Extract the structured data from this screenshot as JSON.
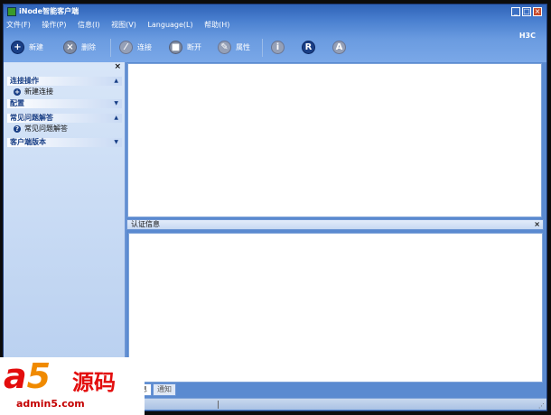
{
  "window": {
    "title": "iNode智能客户端",
    "brand": "H3C"
  },
  "menubar": [
    "文件(F)",
    "操作(P)",
    "信息(I)",
    "视图(V)",
    "Language(L)",
    "帮助(H)"
  ],
  "toolbar": {
    "new_label": "新建",
    "delete_label": "删除",
    "connect_label": "连接",
    "disconnect_label": "断开",
    "properties_label": "属性",
    "info_icon": "i",
    "r_icon": "R",
    "a_icon": "A"
  },
  "sidebar": {
    "close_glyph": "×",
    "groups": [
      {
        "title": "连接操作",
        "chevron": "▲",
        "item": "新建连接"
      },
      {
        "title": "配置",
        "chevron": "▼"
      },
      {
        "title": "常见问题解答",
        "chevron": "▲",
        "item": "常见问题解答"
      },
      {
        "title": "客户端版本",
        "chevron": "▼"
      }
    ]
  },
  "auth_panel": {
    "title": "认证信息",
    "close_glyph": "×"
  },
  "tabs": [
    "信息",
    "通知"
  ],
  "watermark": {
    "a": "a",
    "five": "5",
    "cn": "源码",
    "url": "admin5.com"
  },
  "colors": {
    "accent": "#2f63b8",
    "panel_bg": "#d8e6f8",
    "watermark_red": "#e30d0d"
  }
}
